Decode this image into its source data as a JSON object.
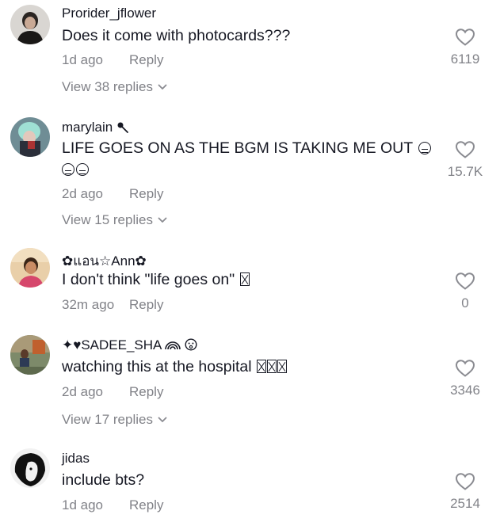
{
  "comments": [
    {
      "username": "Prorider_jflower",
      "text": "Does it come with photocards???",
      "time": "1d ago",
      "reply_label": "Reply",
      "likes": "6119",
      "view_replies": "View 38 replies"
    },
    {
      "username": "marylain",
      "text": "LIFE GOES ON AS THE BGM IS TAKING ME OUT",
      "time": "2d ago",
      "reply_label": "Reply",
      "likes": "15.7K",
      "view_replies": "View 15 replies"
    },
    {
      "username": "แอน☆Ann",
      "text": "I don't think \"life goes on\"",
      "time": "32m ago",
      "reply_label": "Reply",
      "likes": "0"
    },
    {
      "username": "✦♥SADEE_SHA",
      "text": "watching this at the hospital",
      "time": "2d ago",
      "reply_label": "Reply",
      "likes": "3346",
      "view_replies": "View 17 replies"
    },
    {
      "username": "jidas",
      "text": "include bts?",
      "time": "1d ago",
      "reply_label": "Reply",
      "likes": "2514"
    }
  ],
  "icons": {
    "like": "heart-outline-icon",
    "expand": "chevron-down-icon"
  },
  "colors": {
    "text_primary": "#161823",
    "text_secondary": "#8a8b91"
  }
}
